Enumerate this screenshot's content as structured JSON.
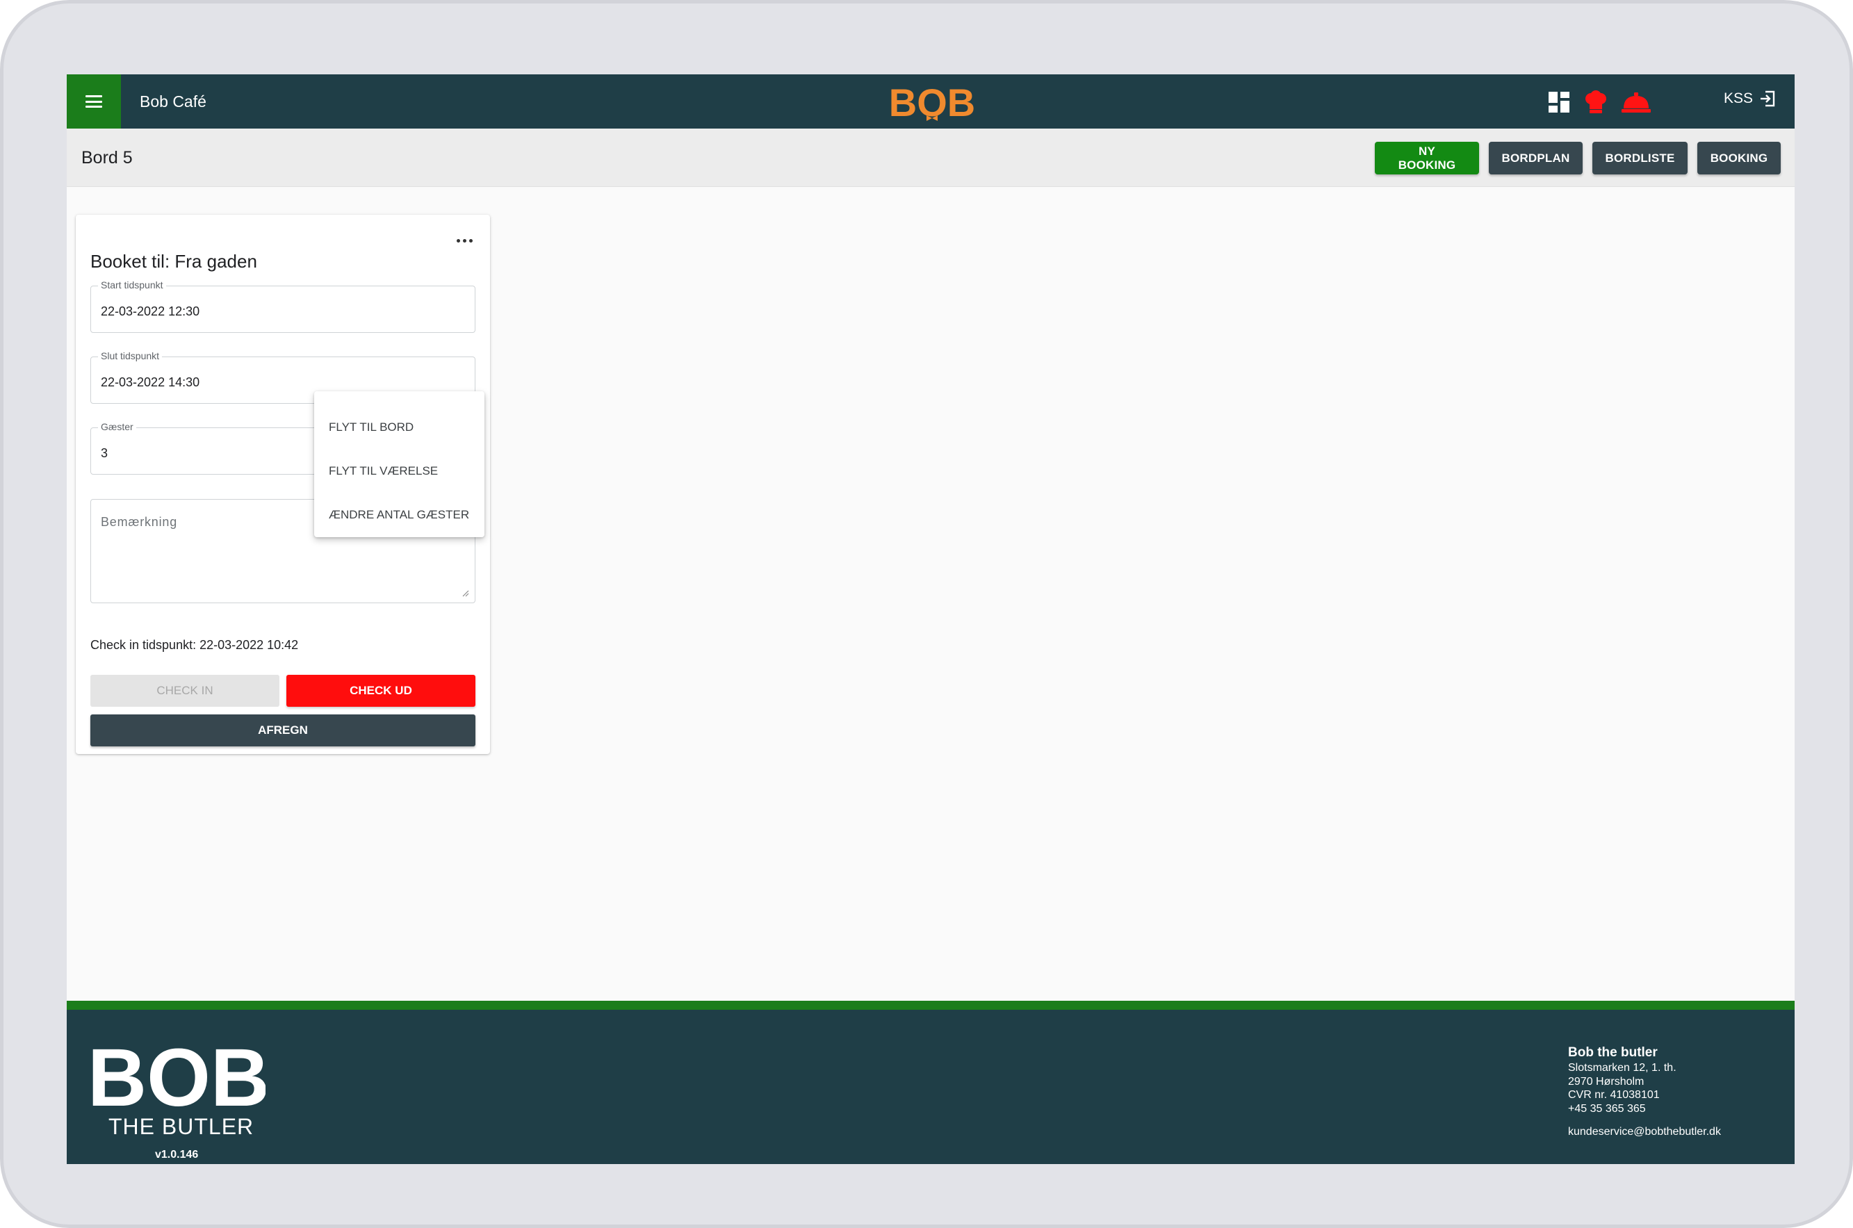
{
  "app": {
    "cafe_name": "Bob Café",
    "logo_text": "BOB",
    "brand_orange": "#f08a2e",
    "brand_dark": "#1f3e47",
    "brand_green": "#1b7d1b"
  },
  "topbar": {
    "icons": [
      "dashboard-icon",
      "chef-hat-icon",
      "room-service-bell-icon",
      "logout-icon"
    ],
    "user_initials": "KSS"
  },
  "subheader": {
    "title": "Bord 5",
    "buttons": {
      "new_booking": "NY BOOKING",
      "table_plan": "BORDPLAN",
      "table_list": "BORDLISTE",
      "booking": "BOOKING"
    }
  },
  "card": {
    "title": "Booket til: Fra gaden",
    "start": {
      "label": "Start tidspunkt",
      "value": "22-03-2022 12:30"
    },
    "end": {
      "label": "Slut tidspunkt",
      "value": "22-03-2022 14:30"
    },
    "guests": {
      "label": "Gæster",
      "value": "3"
    },
    "remark": {
      "placeholder": "Bemærkning"
    },
    "checkin_time": "Check in tidspunkt: 22-03-2022 10:42",
    "btn_checkin": "CHECK IN",
    "btn_checkout": "CHECK UD",
    "btn_settle": "AFREGN",
    "checkout_color": "#ff0d0d"
  },
  "dropdown": {
    "items": [
      "FLYT TIL BORD",
      "FLYT TIL VÆRELSE",
      "ÆNDRE ANTAL GÆSTER"
    ]
  },
  "footer": {
    "logo_text": "BOB",
    "tagline": "THE BUTLER",
    "version": "v1.0.146",
    "company": {
      "name": "Bob the butler",
      "street": "Slotsmarken 12, 1. th.",
      "city": "2970 Hørsholm",
      "cvr": "CVR nr. 41038101",
      "phone": "+45 35 365 365",
      "email": "kundeservice@bobthebutler.dk"
    }
  }
}
